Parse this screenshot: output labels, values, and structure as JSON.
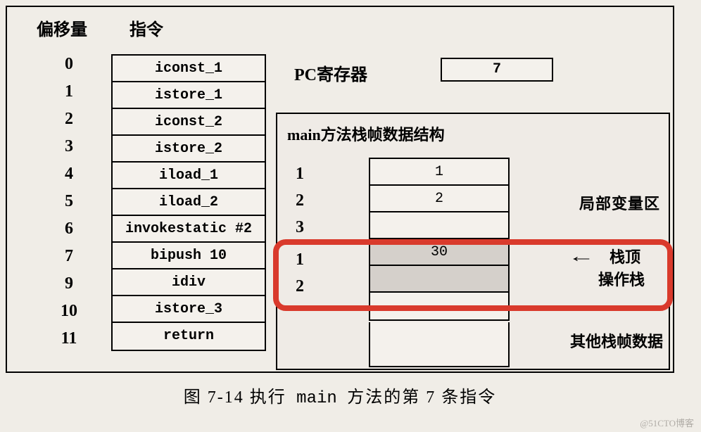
{
  "headers": {
    "offset": "偏移量",
    "instruction": "指令"
  },
  "instructions": [
    {
      "offset": "0",
      "instr": "iconst_1"
    },
    {
      "offset": "1",
      "instr": "istore_1"
    },
    {
      "offset": "2",
      "instr": "iconst_2"
    },
    {
      "offset": "3",
      "instr": "istore_2"
    },
    {
      "offset": "4",
      "instr": "iload_1"
    },
    {
      "offset": "5",
      "instr": "iload_2"
    },
    {
      "offset": "6",
      "instr": "invokestatic  #2"
    },
    {
      "offset": "7",
      "instr": "bipush   10"
    },
    {
      "offset": "9",
      "instr": "idiv"
    },
    {
      "offset": "10",
      "instr": "istore_3"
    },
    {
      "offset": "11",
      "instr": "return"
    }
  ],
  "pc": {
    "label": "PC寄存器",
    "value": "7"
  },
  "stackframe": {
    "title": "main方法栈帧数据结构",
    "localvars": {
      "label": "局部变量区",
      "indexes": [
        "1",
        "2",
        "3"
      ],
      "values": [
        "1",
        "2",
        ""
      ]
    },
    "opstack": {
      "label": "操作栈",
      "top_label": "栈顶",
      "indexes": [
        "1",
        "2"
      ],
      "values": [
        "30",
        ""
      ]
    },
    "other_label": "其他栈帧数据"
  },
  "caption": {
    "prefix": "图 7-14  执行",
    "mono": " main ",
    "suffix": "方法的第 7 条指令"
  },
  "watermark": "@51CTO博客"
}
